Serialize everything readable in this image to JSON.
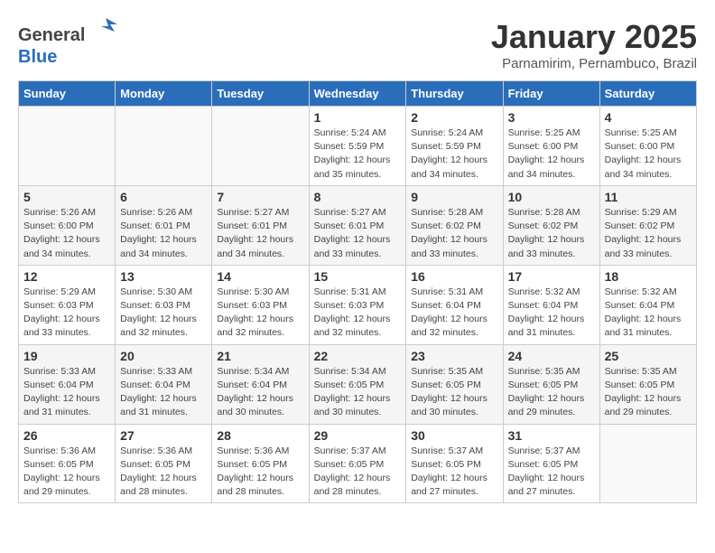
{
  "header": {
    "logo_general": "General",
    "logo_blue": "Blue",
    "title": "January 2025",
    "subtitle": "Parnamirim, Pernambuco, Brazil"
  },
  "days_of_week": [
    "Sunday",
    "Monday",
    "Tuesday",
    "Wednesday",
    "Thursday",
    "Friday",
    "Saturday"
  ],
  "weeks": [
    [
      {
        "num": "",
        "info": ""
      },
      {
        "num": "",
        "info": ""
      },
      {
        "num": "",
        "info": ""
      },
      {
        "num": "1",
        "info": "Sunrise: 5:24 AM\nSunset: 5:59 PM\nDaylight: 12 hours\nand 35 minutes."
      },
      {
        "num": "2",
        "info": "Sunrise: 5:24 AM\nSunset: 5:59 PM\nDaylight: 12 hours\nand 34 minutes."
      },
      {
        "num": "3",
        "info": "Sunrise: 5:25 AM\nSunset: 6:00 PM\nDaylight: 12 hours\nand 34 minutes."
      },
      {
        "num": "4",
        "info": "Sunrise: 5:25 AM\nSunset: 6:00 PM\nDaylight: 12 hours\nand 34 minutes."
      }
    ],
    [
      {
        "num": "5",
        "info": "Sunrise: 5:26 AM\nSunset: 6:00 PM\nDaylight: 12 hours\nand 34 minutes."
      },
      {
        "num": "6",
        "info": "Sunrise: 5:26 AM\nSunset: 6:01 PM\nDaylight: 12 hours\nand 34 minutes."
      },
      {
        "num": "7",
        "info": "Sunrise: 5:27 AM\nSunset: 6:01 PM\nDaylight: 12 hours\nand 34 minutes."
      },
      {
        "num": "8",
        "info": "Sunrise: 5:27 AM\nSunset: 6:01 PM\nDaylight: 12 hours\nand 33 minutes."
      },
      {
        "num": "9",
        "info": "Sunrise: 5:28 AM\nSunset: 6:02 PM\nDaylight: 12 hours\nand 33 minutes."
      },
      {
        "num": "10",
        "info": "Sunrise: 5:28 AM\nSunset: 6:02 PM\nDaylight: 12 hours\nand 33 minutes."
      },
      {
        "num": "11",
        "info": "Sunrise: 5:29 AM\nSunset: 6:02 PM\nDaylight: 12 hours\nand 33 minutes."
      }
    ],
    [
      {
        "num": "12",
        "info": "Sunrise: 5:29 AM\nSunset: 6:03 PM\nDaylight: 12 hours\nand 33 minutes."
      },
      {
        "num": "13",
        "info": "Sunrise: 5:30 AM\nSunset: 6:03 PM\nDaylight: 12 hours\nand 32 minutes."
      },
      {
        "num": "14",
        "info": "Sunrise: 5:30 AM\nSunset: 6:03 PM\nDaylight: 12 hours\nand 32 minutes."
      },
      {
        "num": "15",
        "info": "Sunrise: 5:31 AM\nSunset: 6:03 PM\nDaylight: 12 hours\nand 32 minutes."
      },
      {
        "num": "16",
        "info": "Sunrise: 5:31 AM\nSunset: 6:04 PM\nDaylight: 12 hours\nand 32 minutes."
      },
      {
        "num": "17",
        "info": "Sunrise: 5:32 AM\nSunset: 6:04 PM\nDaylight: 12 hours\nand 31 minutes."
      },
      {
        "num": "18",
        "info": "Sunrise: 5:32 AM\nSunset: 6:04 PM\nDaylight: 12 hours\nand 31 minutes."
      }
    ],
    [
      {
        "num": "19",
        "info": "Sunrise: 5:33 AM\nSunset: 6:04 PM\nDaylight: 12 hours\nand 31 minutes."
      },
      {
        "num": "20",
        "info": "Sunrise: 5:33 AM\nSunset: 6:04 PM\nDaylight: 12 hours\nand 31 minutes."
      },
      {
        "num": "21",
        "info": "Sunrise: 5:34 AM\nSunset: 6:04 PM\nDaylight: 12 hours\nand 30 minutes."
      },
      {
        "num": "22",
        "info": "Sunrise: 5:34 AM\nSunset: 6:05 PM\nDaylight: 12 hours\nand 30 minutes."
      },
      {
        "num": "23",
        "info": "Sunrise: 5:35 AM\nSunset: 6:05 PM\nDaylight: 12 hours\nand 30 minutes."
      },
      {
        "num": "24",
        "info": "Sunrise: 5:35 AM\nSunset: 6:05 PM\nDaylight: 12 hours\nand 29 minutes."
      },
      {
        "num": "25",
        "info": "Sunrise: 5:35 AM\nSunset: 6:05 PM\nDaylight: 12 hours\nand 29 minutes."
      }
    ],
    [
      {
        "num": "26",
        "info": "Sunrise: 5:36 AM\nSunset: 6:05 PM\nDaylight: 12 hours\nand 29 minutes."
      },
      {
        "num": "27",
        "info": "Sunrise: 5:36 AM\nSunset: 6:05 PM\nDaylight: 12 hours\nand 28 minutes."
      },
      {
        "num": "28",
        "info": "Sunrise: 5:36 AM\nSunset: 6:05 PM\nDaylight: 12 hours\nand 28 minutes."
      },
      {
        "num": "29",
        "info": "Sunrise: 5:37 AM\nSunset: 6:05 PM\nDaylight: 12 hours\nand 28 minutes."
      },
      {
        "num": "30",
        "info": "Sunrise: 5:37 AM\nSunset: 6:05 PM\nDaylight: 12 hours\nand 27 minutes."
      },
      {
        "num": "31",
        "info": "Sunrise: 5:37 AM\nSunset: 6:05 PM\nDaylight: 12 hours\nand 27 minutes."
      },
      {
        "num": "",
        "info": ""
      }
    ]
  ]
}
